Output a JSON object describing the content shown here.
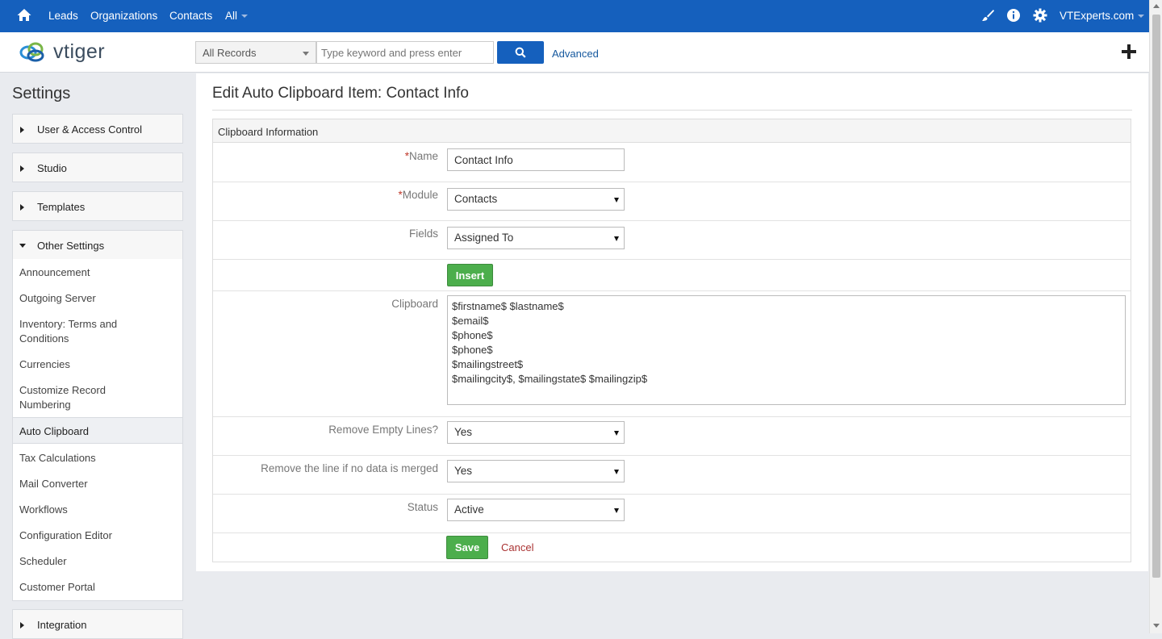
{
  "topnav": {
    "links": [
      "Leads",
      "Organizations",
      "Contacts",
      "All"
    ],
    "user": "VTExperts.com",
    "icons": [
      "home-icon",
      "brush-icon",
      "info-icon",
      "gear-icon"
    ]
  },
  "header": {
    "logo_text": "vtiger",
    "record_select": "All Records",
    "search_placeholder": "Type keyword and press enter",
    "advanced_label": "Advanced"
  },
  "sidebar": {
    "title": "Settings",
    "groups": [
      "User & Access Control",
      "Studio",
      "Templates",
      "Other Settings",
      "Integration"
    ],
    "other_items": [
      "Announcement",
      "Outgoing Server",
      "Inventory: Terms and Conditions",
      "Currencies",
      "Customize Record Numbering",
      "Auto Clipboard",
      "Tax Calculations",
      "Mail Converter",
      "Workflows",
      "Configuration Editor",
      "Scheduler",
      "Customer Portal"
    ]
  },
  "main": {
    "title": "Edit Auto Clipboard Item: Contact Info",
    "section": "Clipboard Information",
    "name_label": "Name",
    "name_value": "Contact Info",
    "module_label": "Module",
    "module_value": "Contacts",
    "fields_label": "Fields",
    "fields_value": "Assigned To",
    "insert_label": "Insert",
    "clipboard_label": "Clipboard",
    "clipboard_value": "$firstname$ $lastname$\n$email$\n$phone$\n$phone$\n$mailingstreet$\n$mailingcity$, $mailingstate$ $mailingzip$",
    "remove_empty_label": "Remove Empty Lines?",
    "remove_empty_value": "Yes",
    "remove_line_label": "Remove the line if no data is merged",
    "remove_line_value": "Yes",
    "status_label": "Status",
    "status_value": "Active",
    "save_label": "Save",
    "cancel_label": "Cancel",
    "required_mark": "*"
  },
  "colors": {
    "nav_blue": "#1560bd",
    "green": "#4cae4c",
    "required": "#c0392b"
  }
}
